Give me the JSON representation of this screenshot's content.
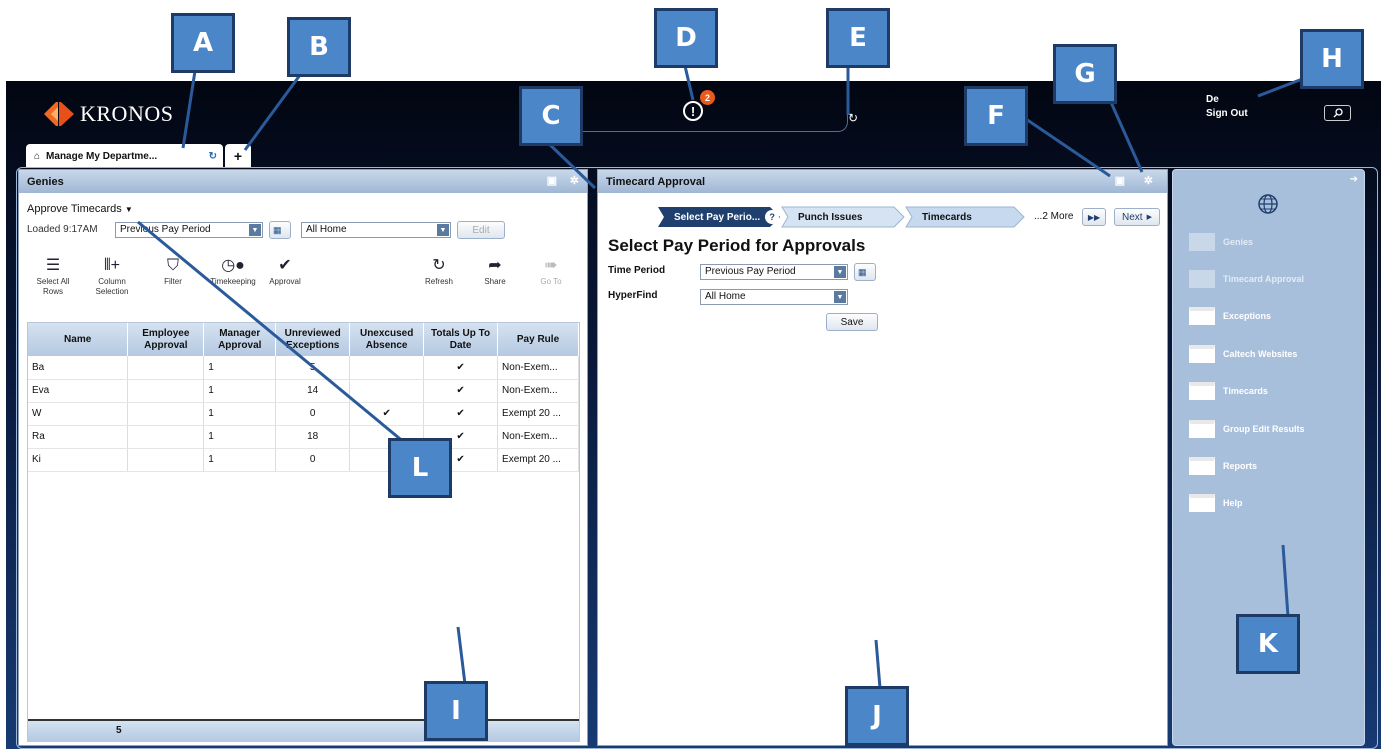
{
  "header": {
    "logo_text": "KRONOS",
    "alert_count": "2",
    "user_name": "De",
    "sign_out_label": "Sign Out"
  },
  "tabs": {
    "active_label": "Manage My Departme...",
    "add_label": "+"
  },
  "genies": {
    "title": "Genies",
    "genie_select": "Approve Timecards",
    "loaded": "Loaded 9:17AM",
    "period_select": "Previous Pay Period",
    "location_select": "All Home",
    "edit_label": "Edit",
    "toolbar": [
      {
        "label": "Select All Rows",
        "icon": "select-all-icon"
      },
      {
        "label": "Column Selection",
        "icon": "column-add-icon"
      },
      {
        "label": "Filter",
        "icon": "filter-icon"
      },
      {
        "label": "Timekeeping",
        "icon": "timekeeping-icon"
      },
      {
        "label": "Approval",
        "icon": "check-icon"
      },
      {
        "label": "Refresh",
        "icon": "refresh-icon"
      },
      {
        "label": "Share",
        "icon": "share-icon"
      },
      {
        "label": "Go To",
        "icon": "goto-icon"
      }
    ],
    "columns": [
      "Name",
      "Employee Approval",
      "Manager Approval",
      "Unreviewed Exceptions",
      "Unexcused Absence",
      "Totals Up To Date",
      "Pay Rule"
    ],
    "rows": [
      {
        "name": "Ba",
        "emp": "",
        "mgr": "1",
        "exc": "5",
        "abs": "",
        "tot": "✔",
        "rule": "Non-Exem..."
      },
      {
        "name": "Eva",
        "emp": "",
        "mgr": "1",
        "exc": "14",
        "abs": "",
        "tot": "✔",
        "rule": "Non-Exem..."
      },
      {
        "name": "W",
        "emp": "",
        "mgr": "1",
        "exc": "0",
        "abs": "✔",
        "tot": "✔",
        "rule": "Exempt 20 ..."
      },
      {
        "name": "Ra",
        "emp": "",
        "mgr": "1",
        "exc": "18",
        "abs": "",
        "tot": "✔",
        "rule": "Non-Exem..."
      },
      {
        "name": "Ki",
        "emp": "",
        "mgr": "1",
        "exc": "0",
        "abs": "",
        "tot": "✔",
        "rule": "Exempt 20 ..."
      }
    ],
    "footer_count": "5"
  },
  "timecard": {
    "title": "Timecard Approval",
    "steps": [
      "Select Pay Perio...",
      "Punch Issues",
      "Timecards"
    ],
    "more_label": "...2 More",
    "next_label": "Next",
    "heading": "Select Pay Period for Approvals",
    "time_period_label": "Time Period",
    "time_period_value": "Previous Pay Period",
    "hyperfind_label": "HyperFind",
    "hyperfind_value": "All Home",
    "save_label": "Save"
  },
  "sidebar": {
    "items": [
      {
        "label": "Genies",
        "dim": true
      },
      {
        "label": "Timecard Approval",
        "dim": true
      },
      {
        "label": "Exceptions",
        "dim": false
      },
      {
        "label": "Caltech Websites",
        "dim": false
      },
      {
        "label": "Timecards",
        "dim": false
      },
      {
        "label": "Group Edit Results",
        "dim": false
      },
      {
        "label": "Reports",
        "dim": false
      },
      {
        "label": "Help",
        "dim": false
      }
    ]
  },
  "callouts": [
    "A",
    "B",
    "C",
    "D",
    "E",
    "F",
    "G",
    "H",
    "I",
    "J",
    "K",
    "L"
  ],
  "colors": {
    "callout_fill": "#4a86c8",
    "alert_badge": "#e85a1d",
    "header_bg": "#020611"
  }
}
